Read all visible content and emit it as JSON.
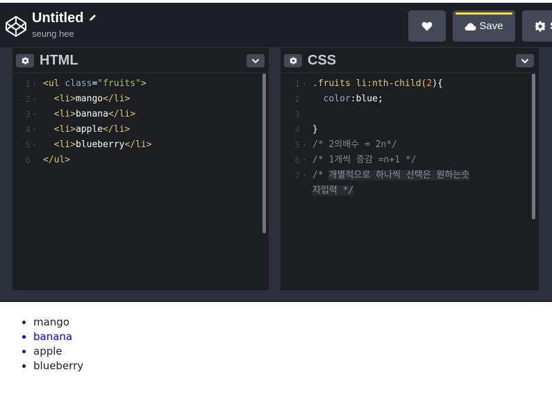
{
  "header": {
    "title": "Untitled",
    "user": "seung hee",
    "save_label": "Save",
    "settings_label": "S"
  },
  "html_pane": {
    "title": "HTML",
    "lines": [
      {
        "n": "1",
        "fold": "▾",
        "parts": [
          {
            "t": "<ul ",
            "c": "c-tag"
          },
          {
            "t": "class",
            "c": "c-attr"
          },
          {
            "t": "=",
            "c": "c-txt"
          },
          {
            "t": "\"fruits\"",
            "c": "c-str"
          },
          {
            "t": ">",
            "c": "c-tag"
          }
        ]
      },
      {
        "n": "2",
        "fold": "▾",
        "parts": [
          {
            "t": "  <li>",
            "c": "c-tag"
          },
          {
            "t": "mango",
            "c": "c-txt"
          },
          {
            "t": "</li>",
            "c": "c-tag"
          }
        ]
      },
      {
        "n": "3",
        "fold": "▾",
        "parts": [
          {
            "t": "  <li>",
            "c": "c-tag"
          },
          {
            "t": "banana",
            "c": "c-txt"
          },
          {
            "t": "</li>",
            "c": "c-tag"
          }
        ]
      },
      {
        "n": "4",
        "fold": "▾",
        "parts": [
          {
            "t": "  <li>",
            "c": "c-tag"
          },
          {
            "t": "apple",
            "c": "c-txt"
          },
          {
            "t": "</li>",
            "c": "c-tag"
          }
        ]
      },
      {
        "n": "5",
        "fold": "▾",
        "parts": [
          {
            "t": "  <li>",
            "c": "c-tag"
          },
          {
            "t": "blueberry",
            "c": "c-txt"
          },
          {
            "t": "</li>",
            "c": "c-tag"
          }
        ]
      },
      {
        "n": "6",
        "fold": "",
        "parts": [
          {
            "t": "</ul>",
            "c": "c-tag"
          }
        ]
      }
    ]
  },
  "css_pane": {
    "title": "CSS",
    "lines": [
      {
        "n": "1",
        "fold": "▾",
        "parts": [
          {
            "t": ".fruits li:nth-child(",
            "c": "c-sel"
          },
          {
            "t": "2",
            "c": "c-num"
          },
          {
            "t": "){",
            "c": "c-brace"
          }
        ]
      },
      {
        "n": "2",
        "fold": "",
        "parts": [
          {
            "t": "  color",
            "c": "c-prop"
          },
          {
            "t": ":",
            "c": "c-txt"
          },
          {
            "t": "blue",
            "c": "c-val"
          },
          {
            "t": ";",
            "c": "c-txt"
          }
        ]
      },
      {
        "n": "3",
        "fold": "",
        "parts": []
      },
      {
        "n": "4",
        "fold": "",
        "parts": [
          {
            "t": "}",
            "c": "c-brace"
          }
        ]
      },
      {
        "n": "5",
        "fold": "▾",
        "parts": [
          {
            "t": "/* 2의배수 = 2n*/",
            "c": "c-cmt"
          }
        ]
      },
      {
        "n": "6",
        "fold": "▾",
        "parts": [
          {
            "t": "/* 1개씩 증감 =n+1 */",
            "c": "c-cmt"
          }
        ]
      },
      {
        "n": "7",
        "fold": "▾",
        "parts": [
          {
            "t": "/* ",
            "c": "c-cmt"
          },
          {
            "t": "개별적으로 하나씩 선택은 원하는숫",
            "c": "c-hl"
          }
        ]
      },
      {
        "n": "",
        "fold": "",
        "parts": [
          {
            "t": "자입력 */",
            "c": "c-hl"
          }
        ]
      }
    ]
  },
  "preview": {
    "items": [
      {
        "label": "mango",
        "highlight": false
      },
      {
        "label": "banana",
        "highlight": true
      },
      {
        "label": "apple",
        "highlight": false
      },
      {
        "label": "blueberry",
        "highlight": false
      }
    ]
  }
}
